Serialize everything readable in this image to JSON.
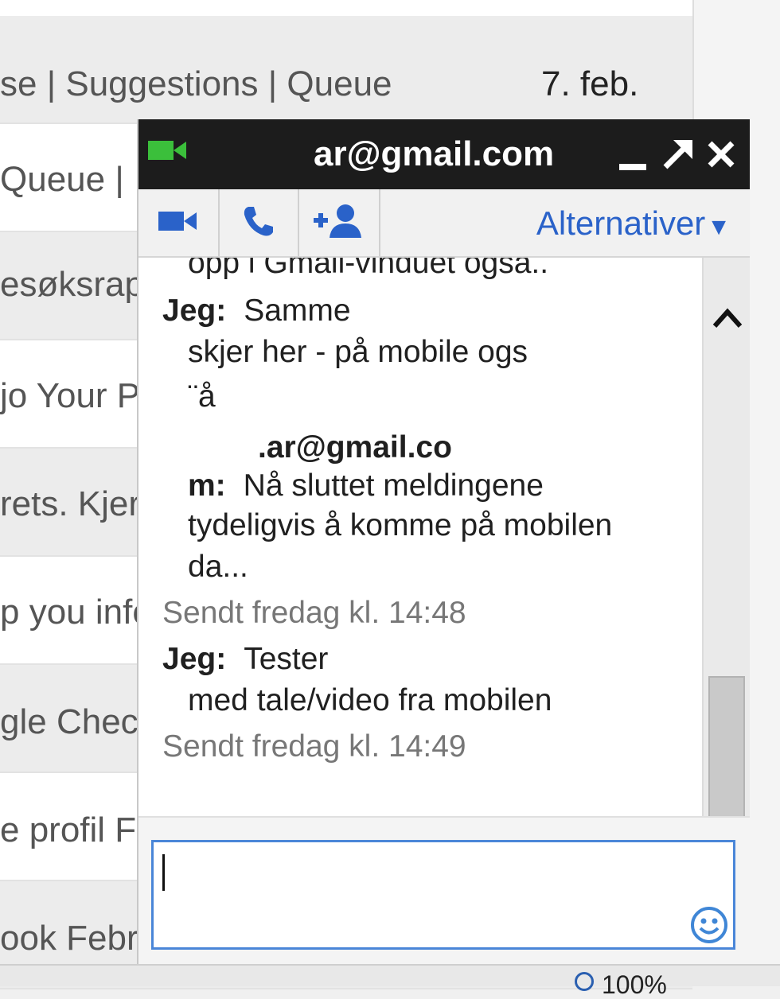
{
  "inbox": {
    "rows": [
      {
        "subject": "se | Suggestions | Queue /",
        "date": "7. feb."
      },
      {
        "subject": " Queue |",
        "date": ""
      },
      {
        "subject": "esøksrap",
        "date": ""
      },
      {
        "subject": "jo Your P",
        "date": ""
      },
      {
        "subject": "rets. Kjer",
        "date": ""
      },
      {
        "subject": "p you info",
        "date": ""
      },
      {
        "subject": "gle Check",
        "date": ""
      },
      {
        "subject": "e profil Fa",
        "date": ""
      },
      {
        "subject": "ook Febru",
        "date": ""
      }
    ]
  },
  "statusbar": {
    "zoom": "100%"
  },
  "chat": {
    "title": "ar@gmail.com",
    "toolbar": {
      "options_label": "Alternativer"
    },
    "messages": {
      "line1": "opp i Gmail-vinduet også..",
      "m1_sender": "Jeg:",
      "m1_text": "Samme",
      "m1_cont1": "skjer her - på mobile ogs",
      "m1_cont2": "¨å",
      "m2_sender_line1": ".ar@gmail.co",
      "m2_sender_line2": "m:",
      "m2_text": "Nå sluttet meldingene",
      "m2_cont1": "tydeligvis å komme på mobilen",
      "m2_cont2": "da...",
      "t1": "Sendt fredag kl. 14:48",
      "m3_sender": "Jeg:",
      "m3_text": "Tester",
      "m3_cont1": "med tale/video fra mobilen",
      "t2": "Sendt fredag kl. 14:49"
    },
    "input": {
      "value": ""
    }
  },
  "colors": {
    "titlebar": "#1c1c1c",
    "accent_blue": "#2a62c9",
    "video_green": "#3bbf3b"
  },
  "icons": [
    "video-icon",
    "minimize-icon",
    "popout-icon",
    "close-icon",
    "phone-icon",
    "add-person-icon",
    "chevron-up-icon",
    "chevron-down-icon",
    "smiley-icon"
  ]
}
